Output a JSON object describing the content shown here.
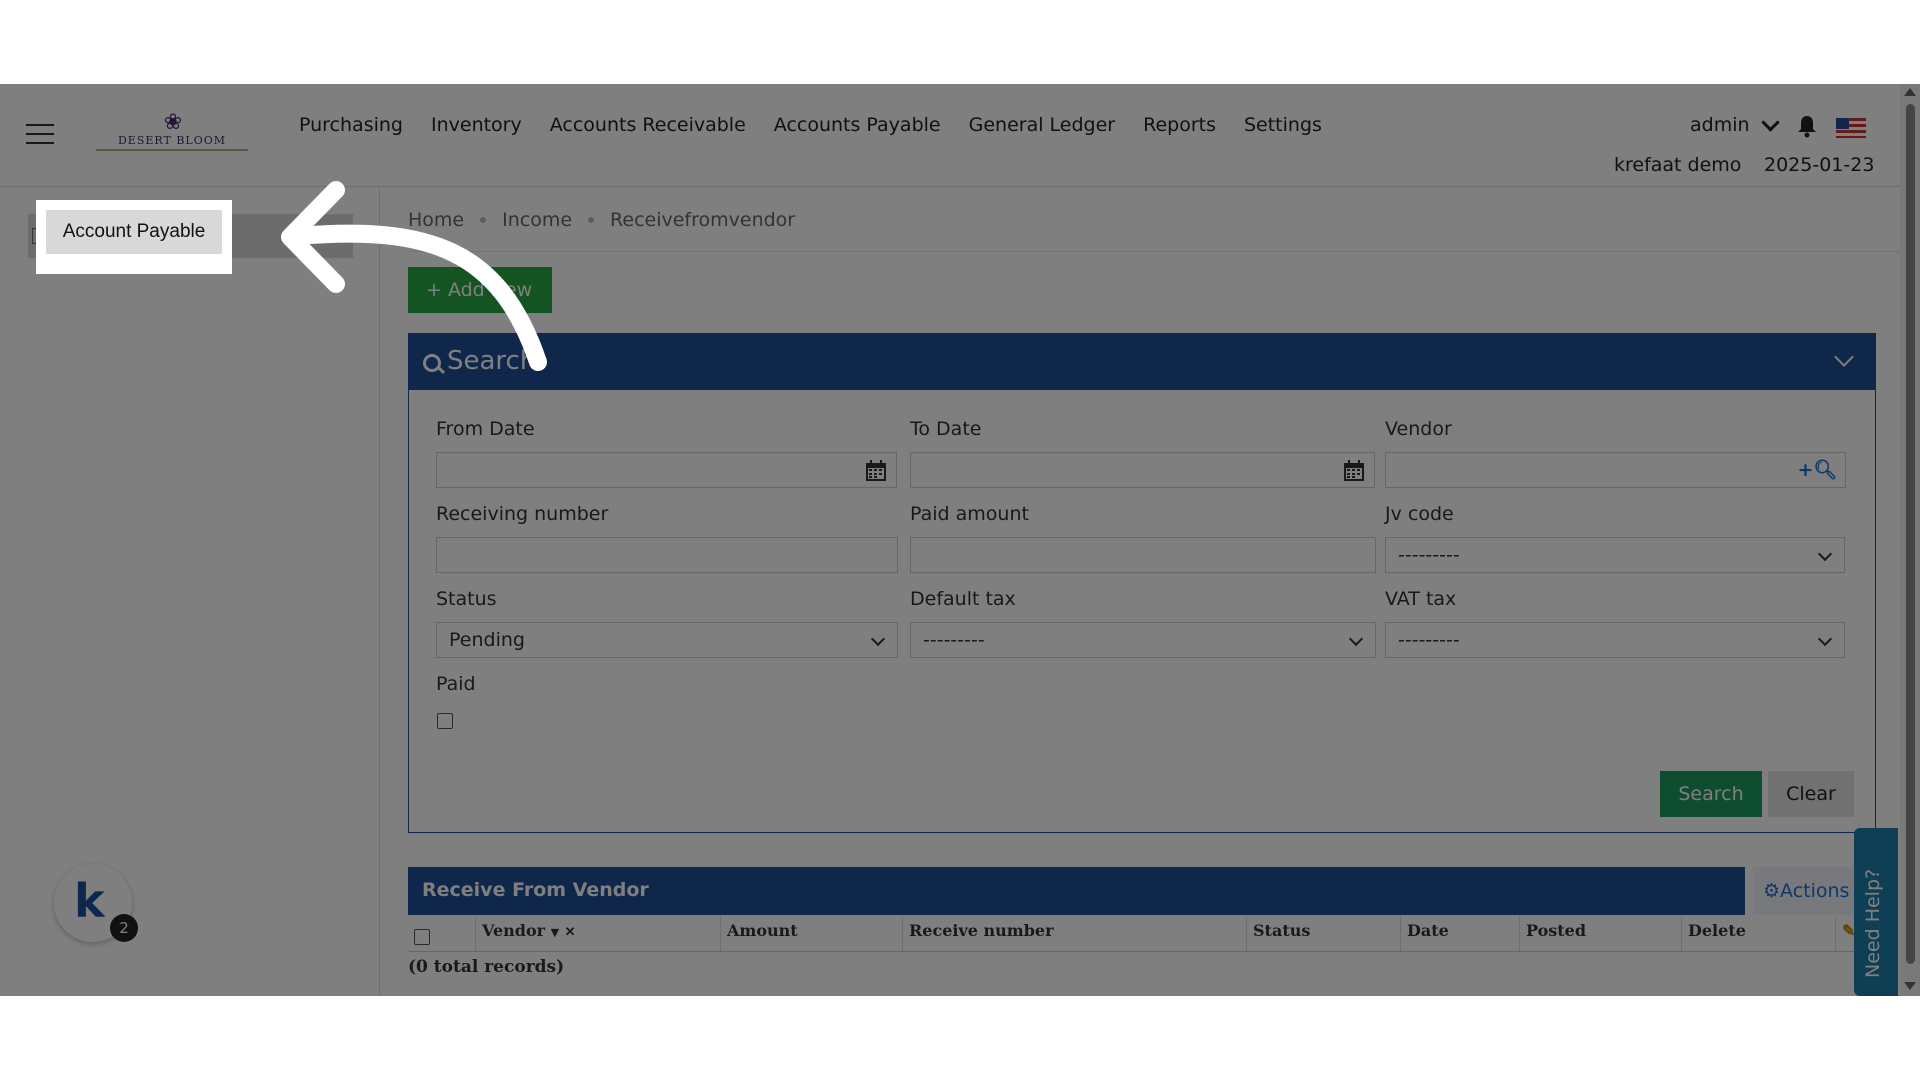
{
  "header": {
    "logo_text": "DESERT BLOOM",
    "nav": [
      "Purchasing",
      "Inventory",
      "Accounts Receivable",
      "Accounts Payable",
      "General Ledger",
      "Reports",
      "Settings"
    ],
    "user": "admin",
    "company": "krefaat demo",
    "date": "2025-01-23"
  },
  "sidebar": {
    "highlight_label": "Account Payable",
    "badge_letter": "k",
    "badge_count": "2"
  },
  "breadcrumb": [
    "Home",
    "Income",
    "Receivefromvendor"
  ],
  "add_new_label": "+ Add New",
  "search_panel": {
    "title": "Search",
    "from_date_label": "From Date",
    "to_date_label": "To Date",
    "vendor_label": "Vendor",
    "receiving_number_label": "Receiving number",
    "paid_amount_label": "Paid amount",
    "jv_code_label": "Jv code",
    "jv_code_value": "---------",
    "status_label": "Status",
    "status_value": "Pending",
    "default_tax_label": "Default tax",
    "default_tax_value": "---------",
    "vat_tax_label": "VAT tax",
    "vat_tax_value": "---------",
    "paid_label": "Paid",
    "search_button": "Search",
    "clear_button": "Clear"
  },
  "results": {
    "title": "Receive From Vendor",
    "actions_label": "Actions",
    "columns": [
      "Vendor",
      "Amount",
      "Receive number",
      "Status",
      "Date",
      "Posted",
      "Delete"
    ],
    "records_text": "(0 total records)"
  },
  "help_label": "Need Help?"
}
